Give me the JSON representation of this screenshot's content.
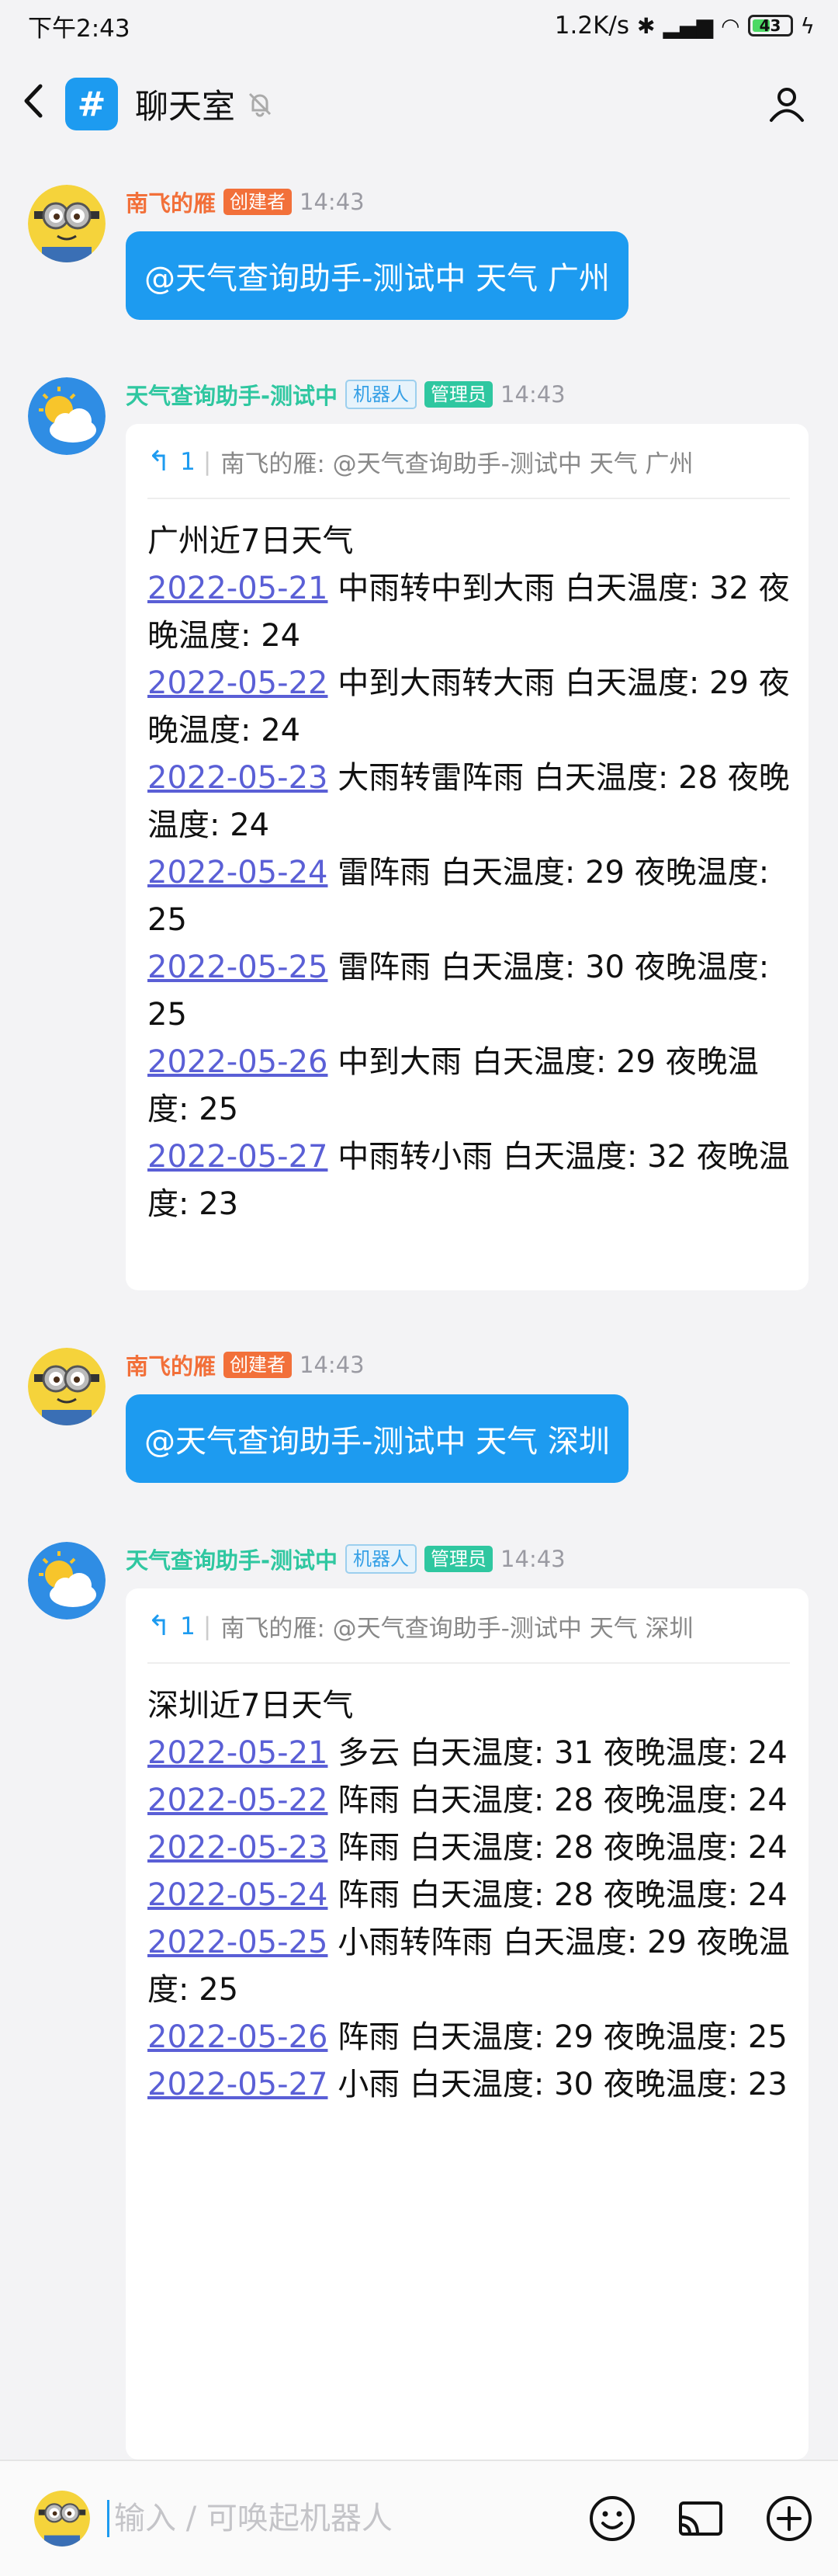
{
  "status": {
    "time": "下午2:43",
    "speed": "1.2K/s",
    "battery": "43"
  },
  "header": {
    "title": "聊天室"
  },
  "messages": [
    {
      "user": "南飞的雁",
      "tag1": "创建者",
      "time": "14:43",
      "text": "@天气查询助手-测试中 天气 广州"
    },
    {
      "user": "天气查询助手-测试中",
      "tag1": "机器人",
      "tag2": "管理员",
      "time": "14:43",
      "reply_count": "1",
      "reply_text": "南飞的雁: @天气查询助手-测试中 天气 广州",
      "title": "广州近7日天气",
      "days": [
        {
          "date": "2022-05-21",
          "desc": "中雨转中到大雨 白天温度: 32 夜晚温度: 24"
        },
        {
          "date": "2022-05-22",
          "desc": "中到大雨转大雨 白天温度: 29 夜晚温度: 24"
        },
        {
          "date": "2022-05-23",
          "desc": "大雨转雷阵雨 白天温度: 28 夜晚温度: 24"
        },
        {
          "date": "2022-05-24",
          "desc": "雷阵雨 白天温度: 29 夜晚温度: 25"
        },
        {
          "date": "2022-05-25",
          "desc": "雷阵雨 白天温度: 30 夜晚温度: 25"
        },
        {
          "date": "2022-05-26",
          "desc": "中到大雨 白天温度: 29 夜晚温度: 25"
        },
        {
          "date": "2022-05-27",
          "desc": "中雨转小雨 白天温度: 32 夜晚温度: 23"
        }
      ]
    },
    {
      "user": "南飞的雁",
      "tag1": "创建者",
      "time": "14:43",
      "text": "@天气查询助手-测试中 天气 深圳"
    },
    {
      "user": "天气查询助手-测试中",
      "tag1": "机器人",
      "tag2": "管理员",
      "time": "14:43",
      "reply_count": "1",
      "reply_text": "南飞的雁: @天气查询助手-测试中 天气 深圳",
      "title": "深圳近7日天气",
      "days": [
        {
          "date": "2022-05-21",
          "desc": "多云 白天温度: 31 夜晚温度: 24"
        },
        {
          "date": "2022-05-22",
          "desc": "阵雨 白天温度: 28 夜晚温度: 24"
        },
        {
          "date": "2022-05-23",
          "desc": "阵雨 白天温度: 28 夜晚温度: 24"
        },
        {
          "date": "2022-05-24",
          "desc": "阵雨 白天温度: 28 夜晚温度: 24"
        },
        {
          "date": "2022-05-25",
          "desc": "小雨转阵雨 白天温度: 29 夜晚温度: 25"
        },
        {
          "date": "2022-05-26",
          "desc": "阵雨 白天温度: 29 夜晚温度: 25"
        },
        {
          "date": "2022-05-27",
          "desc": "小雨 白天温度: 30 夜晚温度: 23"
        }
      ]
    }
  ],
  "input": {
    "placeholder": "输入 / 可唤起机器人"
  },
  "colors": {
    "accent": "#1d9bf0",
    "user_name": "#f2703a",
    "bot_name": "#2fc7a0",
    "link": "#5a5fd6"
  },
  "icons": [
    "back-icon",
    "hash-icon",
    "mute-bell-icon",
    "profile-icon",
    "reply-icon",
    "emoji-icon",
    "cast-icon",
    "add-icon"
  ]
}
